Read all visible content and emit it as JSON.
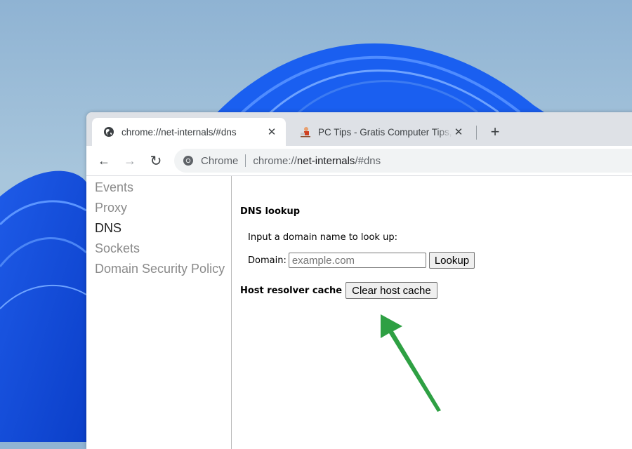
{
  "browser": {
    "tabs": [
      {
        "title": "chrome://net-internals/#dns",
        "favicon": "globe-icon",
        "active": true
      },
      {
        "title": "PC Tips - Gratis Computer Tips, in",
        "favicon": "pctips-favicon",
        "active": false
      }
    ],
    "close_glyph": "✕",
    "new_tab_glyph": "+",
    "nav": {
      "back": "←",
      "forward": "→",
      "reload": "↻"
    },
    "omnibox": {
      "chip": "Chrome",
      "url_prefix": "chrome://",
      "url_host": "net-internals",
      "url_suffix": "/#dns"
    }
  },
  "sidebar": {
    "items": [
      {
        "label": "Events",
        "active": false
      },
      {
        "label": "Proxy",
        "active": false
      },
      {
        "label": "DNS",
        "active": true
      },
      {
        "label": "Sockets",
        "active": false
      },
      {
        "label": "Domain Security Policy",
        "active": false
      }
    ]
  },
  "main": {
    "dns_heading": "DNS lookup",
    "description": "Input a domain name to look up:",
    "domain_label": "Domain:",
    "domain_placeholder": "example.com",
    "domain_value": "",
    "lookup_button": "Lookup",
    "cache_label": "Host resolver cache",
    "clear_cache_button": "Clear host cache"
  },
  "annotation": {
    "type": "arrow",
    "color": "#2ea043",
    "points_to": "clear-host-cache-button"
  }
}
